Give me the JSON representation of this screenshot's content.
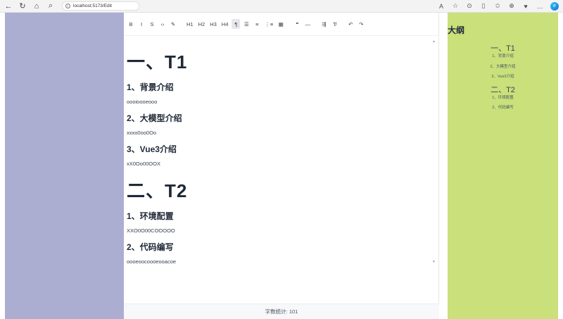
{
  "browser": {
    "url": "localhost:5173/Edit",
    "back_icon": "arrow-left-icon",
    "refresh_icon": "refresh-icon",
    "home_icon": "home-icon",
    "search_icon": "search-icon"
  },
  "toolbar": {
    "buttons": [
      "B",
      "I",
      "S",
      "‹›",
      "✎",
      "H1",
      "H2",
      "H3",
      "H4",
      "¶",
      "☰",
      "≡",
      "⋮≡",
      "▦",
      "❝",
      "—",
      "⇶",
      "T̸",
      "↶",
      "↷"
    ]
  },
  "content": {
    "sections": [
      {
        "title": "一、T1",
        "items": [
          {
            "heading": "1、背景介绍",
            "text": "oooioooeooo"
          },
          {
            "heading": "2、大模型介绍",
            "text": "xxxo0oo0Oo"
          },
          {
            "heading": "3、Vue3介绍",
            "text": "xX0Oo00OOX"
          }
        ]
      },
      {
        "title": "二、T2",
        "items": [
          {
            "heading": "1、环境配置",
            "text": "XXO0O00COOOOO"
          },
          {
            "heading": "2、代码编写",
            "text": "oooeoocoooeooacoe"
          }
        ]
      }
    ]
  },
  "status": {
    "word_count_label": "字数统计: 101"
  },
  "outline": {
    "title": "大纲",
    "entries": [
      {
        "level": 1,
        "label": "一、T1"
      },
      {
        "level": 3,
        "label": "1、背景介绍"
      },
      {
        "level": 3,
        "label": "2、大模型介绍"
      },
      {
        "level": 3,
        "label": "3、Vue3介绍"
      },
      {
        "level": 1,
        "label": "二、T2"
      },
      {
        "level": 3,
        "label": "1、环境配置"
      },
      {
        "level": 3,
        "label": "2、代码编写"
      }
    ]
  },
  "colors": {
    "left_panel": "#abaed1",
    "right_panel": "#c9e07b",
    "heading_text": "#1f2937"
  }
}
